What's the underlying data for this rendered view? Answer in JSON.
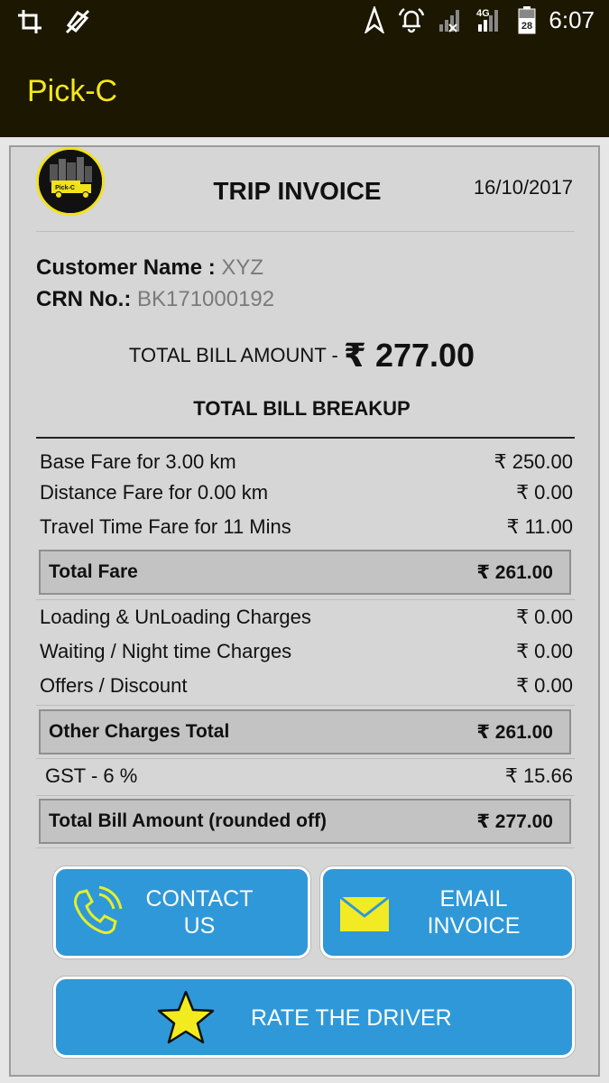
{
  "status_bar": {
    "time": "6:07",
    "network": "4G",
    "battery_level": "28",
    "icons": [
      "crop-icon",
      "no-location-icon",
      "navigation-icon",
      "alarm-icon",
      "signal-icon",
      "signal-4g-icon",
      "battery-icon"
    ]
  },
  "app_bar": {
    "title": "Pick-C"
  },
  "invoice": {
    "logo_text": "Pick-C",
    "title": "TRIP INVOICE",
    "date": "16/10/2017",
    "customer_label": "Customer Name : ",
    "customer_value": "XYZ",
    "crn_label": "CRN No.: ",
    "crn_value": "BK171000192",
    "total_label": "TOTAL BILL AMOUNT - ",
    "total_amount": "₹ 277.00",
    "breakup_title": "TOTAL BILL BREAKUP",
    "fare_rows": [
      {
        "label": "Base Fare for 3.00 km",
        "value": "₹ 250.00"
      },
      {
        "label": "Distance Fare for 0.00 km",
        "value": "₹ 0.00"
      },
      {
        "label": "Travel Time Fare for 11 Mins",
        "value": "₹ 11.00"
      }
    ],
    "total_fare": {
      "label": "Total Fare",
      "value": "₹ 261.00"
    },
    "charge_rows": [
      {
        "label": "Loading & UnLoading Charges",
        "value": "₹ 0.00"
      },
      {
        "label": "Waiting / Night time Charges",
        "value": "₹ 0.00"
      },
      {
        "label": "Offers / Discount",
        "value": "₹ 0.00"
      }
    ],
    "other_total": {
      "label": "Other Charges Total",
      "value": "₹ 261.00"
    },
    "gst": {
      "label": "GST - 6 %",
      "value": "₹ 15.66"
    },
    "rounded_total": {
      "label": "Total Bill Amount (rounded off)",
      "value": "₹ 277.00"
    }
  },
  "actions": {
    "contact_line1": "CONTACT",
    "contact_line2": "US",
    "email_line1": "EMAIL",
    "email_line2": "INVOICE",
    "rate": "RATE THE DRIVER"
  },
  "colors": {
    "app_bar": "#1c1700",
    "brand_yellow": "#f4e71a",
    "button_blue": "#2f98d9",
    "card_bg": "#d6d6d6"
  }
}
